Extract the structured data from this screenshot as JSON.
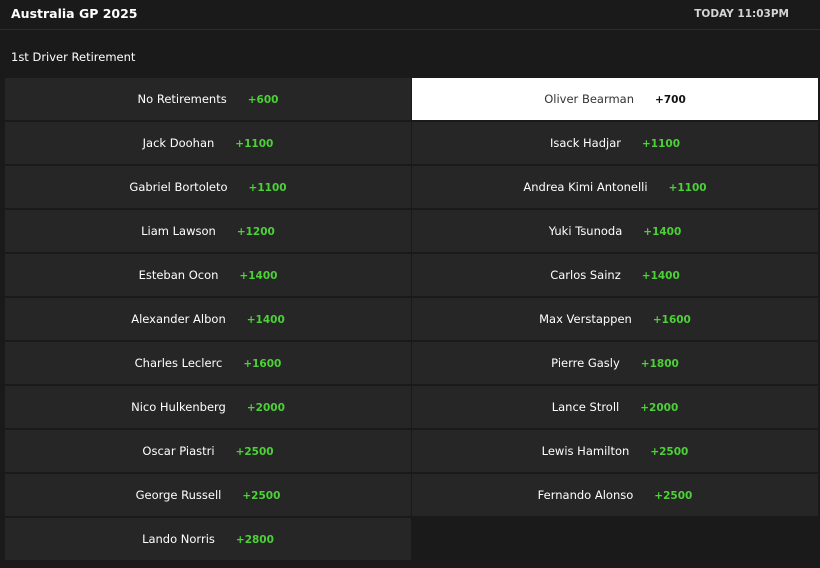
{
  "event": {
    "title": "Australia GP 2025",
    "time": "TODAY 11:03PM"
  },
  "market": {
    "title": "1st Driver Retirement"
  },
  "colors": {
    "background": "#1a1a1a",
    "cell": "#262626",
    "selected": "#ffffff",
    "odds": "#4cd137"
  },
  "selections": [
    {
      "name": "No Retirements",
      "odds": "+600",
      "selected": false
    },
    {
      "name": "Oliver Bearman",
      "odds": "+700",
      "selected": true
    },
    {
      "name": "Jack Doohan",
      "odds": "+1100",
      "selected": false
    },
    {
      "name": "Isack Hadjar",
      "odds": "+1100",
      "selected": false
    },
    {
      "name": "Gabriel Bortoleto",
      "odds": "+1100",
      "selected": false
    },
    {
      "name": "Andrea Kimi Antonelli",
      "odds": "+1100",
      "selected": false
    },
    {
      "name": "Liam Lawson",
      "odds": "+1200",
      "selected": false
    },
    {
      "name": "Yuki Tsunoda",
      "odds": "+1400",
      "selected": false
    },
    {
      "name": "Esteban Ocon",
      "odds": "+1400",
      "selected": false
    },
    {
      "name": "Carlos Sainz",
      "odds": "+1400",
      "selected": false
    },
    {
      "name": "Alexander Albon",
      "odds": "+1400",
      "selected": false
    },
    {
      "name": "Max Verstappen",
      "odds": "+1600",
      "selected": false
    },
    {
      "name": "Charles Leclerc",
      "odds": "+1600",
      "selected": false
    },
    {
      "name": "Pierre Gasly",
      "odds": "+1800",
      "selected": false
    },
    {
      "name": "Nico Hulkenberg",
      "odds": "+2000",
      "selected": false
    },
    {
      "name": "Lance Stroll",
      "odds": "+2000",
      "selected": false
    },
    {
      "name": "Oscar Piastri",
      "odds": "+2500",
      "selected": false
    },
    {
      "name": "Lewis Hamilton",
      "odds": "+2500",
      "selected": false
    },
    {
      "name": "George Russell",
      "odds": "+2500",
      "selected": false
    },
    {
      "name": "Fernando Alonso",
      "odds": "+2500",
      "selected": false
    },
    {
      "name": "Lando Norris",
      "odds": "+2800",
      "selected": false
    }
  ]
}
